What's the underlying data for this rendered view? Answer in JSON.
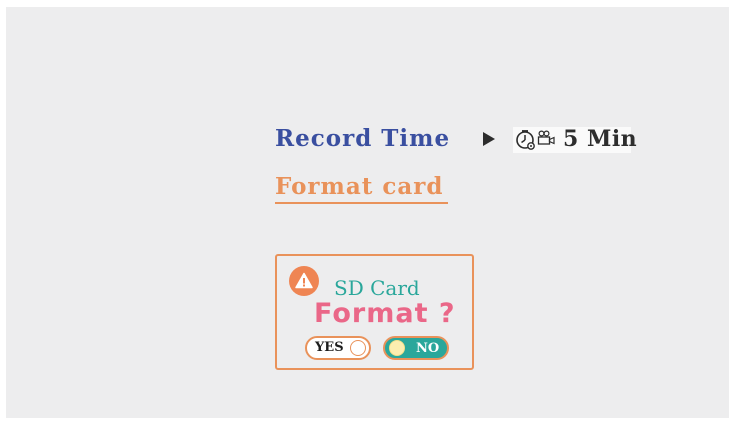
{
  "menu": {
    "record_time": {
      "label": "Record Time",
      "value": "5 Min",
      "icons": [
        "timer-gear-icon",
        "video-camera-icon"
      ]
    },
    "format_card": {
      "label": "Format card",
      "selected": true
    }
  },
  "dialog": {
    "icon": "warning-icon",
    "title": "SD Card",
    "question": "Format ?",
    "options": {
      "yes": {
        "label": "YES",
        "selected": false
      },
      "no": {
        "label": "NO",
        "selected": true
      }
    }
  },
  "colors": {
    "background": "#ededee",
    "menu_label": "#3a4fa0",
    "accent_orange": "#e9925a",
    "teal": "#2aa79b",
    "pink": "#ea6788"
  }
}
